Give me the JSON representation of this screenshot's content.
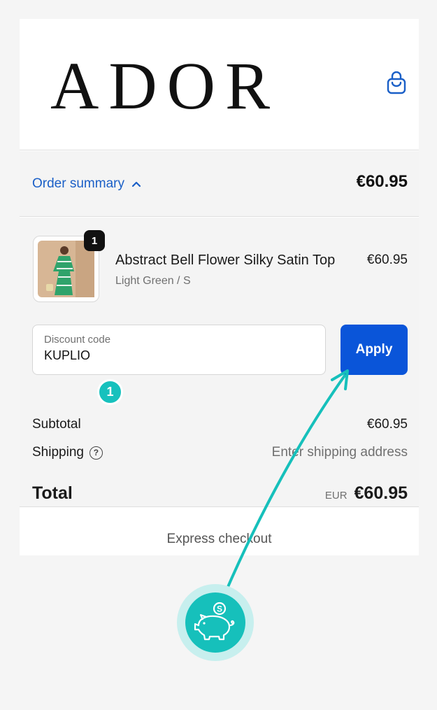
{
  "header": {
    "brand": "ADOR",
    "cart_icon": "shopping-bag-icon"
  },
  "summary": {
    "toggle_label": "Order summary",
    "toggle_icon": "chevron-up-icon",
    "total": "€60.95"
  },
  "cart": {
    "items": [
      {
        "name": "Abstract Bell Flower Silky Satin Top",
        "variant": "Light Green / S",
        "price": "€60.95",
        "quantity": "1"
      }
    ]
  },
  "discount": {
    "label": "Discount code",
    "value": "KUPLIO",
    "apply_label": "Apply",
    "marker": "1"
  },
  "totals": {
    "subtotal_label": "Subtotal",
    "subtotal_value": "€60.95",
    "shipping_label": "Shipping",
    "shipping_help_icon": "help-circle-icon",
    "shipping_value": "Enter shipping address",
    "total_label": "Total",
    "currency": "EUR",
    "total_value": "€60.95"
  },
  "express": {
    "label": "Express checkout"
  },
  "colors": {
    "accent_blue": "#0a55d9",
    "link_blue": "#1a5fc7",
    "teal": "#16c0bb"
  }
}
